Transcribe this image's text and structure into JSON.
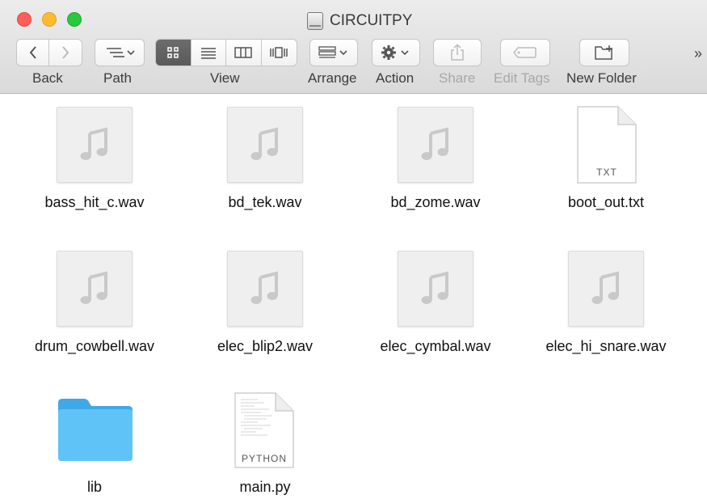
{
  "window": {
    "title": "CIRCUITPY"
  },
  "toolbar": {
    "back_label": "Back",
    "path_label": "Path",
    "view_label": "View",
    "arrange_label": "Arrange",
    "action_label": "Action",
    "share_label": "Share",
    "edit_tags_label": "Edit Tags",
    "new_folder_label": "New Folder",
    "overflow_glyph": "»",
    "active_view": "icon"
  },
  "files": [
    {
      "name": "bass_hit_c.wav",
      "kind": "audio"
    },
    {
      "name": "bd_tek.wav",
      "kind": "audio"
    },
    {
      "name": "bd_zome.wav",
      "kind": "audio"
    },
    {
      "name": "boot_out.txt",
      "kind": "text",
      "badge": "TXT"
    },
    {
      "name": "drum_cowbell.wav",
      "kind": "audio"
    },
    {
      "name": "elec_blip2.wav",
      "kind": "audio"
    },
    {
      "name": "elec_cymbal.wav",
      "kind": "audio"
    },
    {
      "name": "elec_hi_snare.wav",
      "kind": "audio"
    },
    {
      "name": "lib",
      "kind": "folder"
    },
    {
      "name": "main.py",
      "kind": "python",
      "badge": "PYTHON"
    }
  ],
  "colors": {
    "close": "#fc5f57",
    "minimize": "#fdbc2e",
    "maximize": "#2ac840",
    "folder": "#4fb9f2",
    "audio_glyph": "#c9c9c9"
  }
}
